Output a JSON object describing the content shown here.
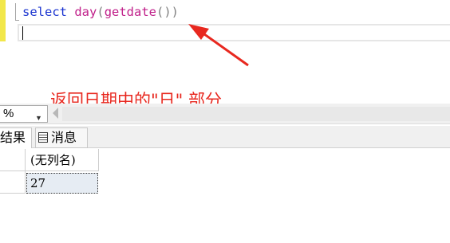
{
  "editor": {
    "code_tokens": [
      {
        "text": "select",
        "role": "keyword"
      },
      {
        "text": " ",
        "role": "space"
      },
      {
        "text": "day",
        "role": "function"
      },
      {
        "text": "(",
        "role": "punct"
      },
      {
        "text": "getdate",
        "role": "function"
      },
      {
        "text": "())",
        "role": "punct"
      }
    ]
  },
  "annotation": {
    "text": "返回日期中的\"日\" 部分",
    "color": "#e8281f"
  },
  "toolbar": {
    "zoom_value": "%"
  },
  "tabs": {
    "results_label": "结果",
    "messages_label": "消息"
  },
  "grid": {
    "column_header": "(无列名)",
    "rows": [
      "27"
    ]
  },
  "colors": {
    "keyword": "#1c35d0",
    "function": "#c0208a",
    "punct": "#808080",
    "selected_cell": "#e6ecf3"
  }
}
